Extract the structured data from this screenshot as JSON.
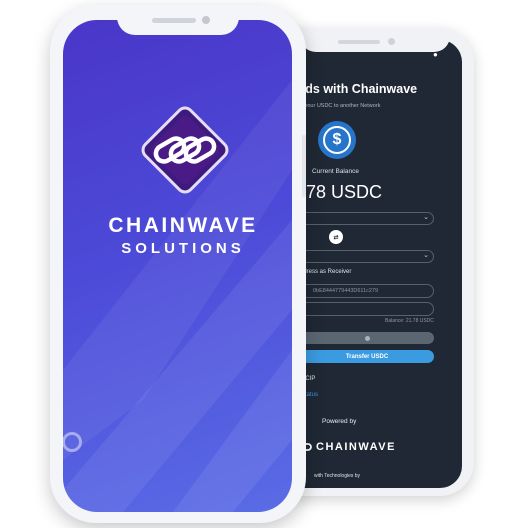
{
  "splash": {
    "brand_line1": "CHAINWAVE",
    "brand_line2": "SOLUTIONS",
    "logo_icon": "chain-link-diamond-icon",
    "colors": {
      "gradient_start": "#4a36c8",
      "gradient_end": "#5a6ce6",
      "logo_bg": "#4a1a86"
    }
  },
  "app": {
    "heading": "unds with Chainwave",
    "subheading": "g your USDC to another Network",
    "token_icon": "usdc-icon",
    "balance_label": "Current Balance",
    "balance_value": ".78 USDC",
    "swap_icon": "⇄",
    "receiver_label": "ddress as Receiver",
    "receiver_value": "0bE8444779443D611c279",
    "balance_hint": "Balance: 21.78 USDC",
    "transfer_label": "Transfer USDC",
    "ccip_text": "CCIP",
    "status_link": "Status",
    "powered_by": "Powered by",
    "powered_brand": "CHAINWAVE",
    "tech_text": "with Technologies by",
    "colors": {
      "background": "#1f2834",
      "primary_button": "#3b9be0",
      "usdc": "#2775ca"
    }
  }
}
